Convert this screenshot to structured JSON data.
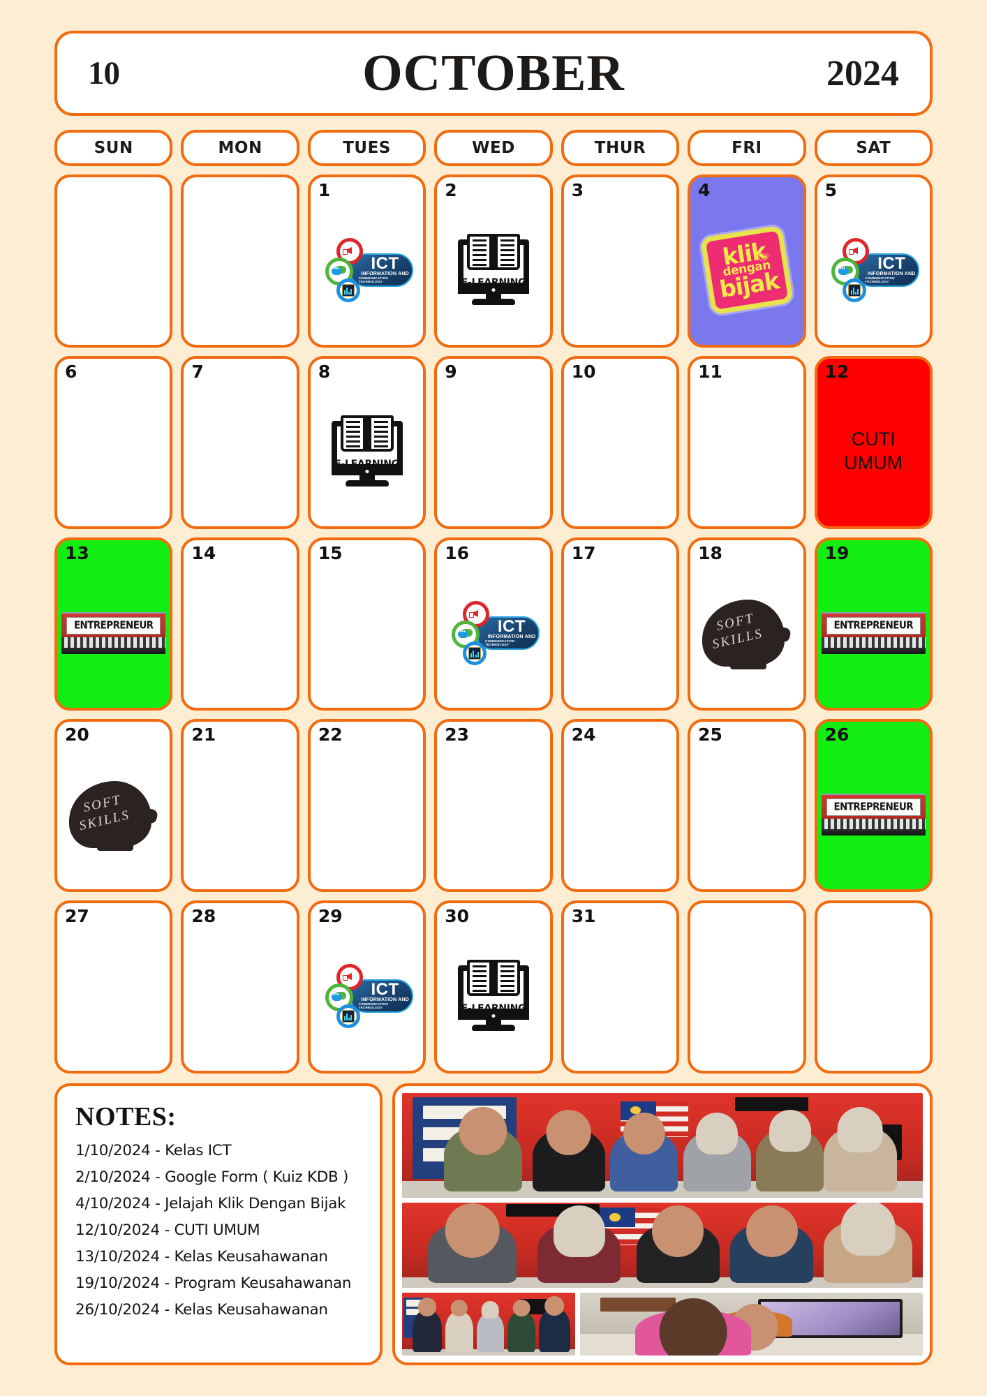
{
  "header": {
    "month_number": "10",
    "month_name": "OCTOBER",
    "year": "2024"
  },
  "colors": {
    "page_background": "#FCEDD3",
    "border_orange": "#F26B0F",
    "cell_white": "#FFFFFF",
    "holiday_red": "#FF0000",
    "event_green": "#12EE12",
    "kdb_purple": "#7B78EE",
    "text_black": "#16130F"
  },
  "weekdays": [
    {
      "label": "SUN"
    },
    {
      "label": "MON"
    },
    {
      "label": "TUES"
    },
    {
      "label": "WED"
    },
    {
      "label": "THUR"
    },
    {
      "label": "FRI"
    },
    {
      "label": "SAT"
    }
  ],
  "calendar": {
    "cells": [
      {
        "day": "",
        "kind": "empty",
        "icon": "none"
      },
      {
        "day": "",
        "kind": "empty",
        "icon": "none"
      },
      {
        "day": "1",
        "kind": "plain",
        "icon": "ict-logo"
      },
      {
        "day": "2",
        "kind": "plain",
        "icon": "e-learning-monitor"
      },
      {
        "day": "3",
        "kind": "plain",
        "icon": "none"
      },
      {
        "day": "4",
        "kind": "purple",
        "icon": "klik-dengan-bijak-badge"
      },
      {
        "day": "5",
        "kind": "plain",
        "icon": "ict-logo"
      },
      {
        "day": "6",
        "kind": "plain",
        "icon": "none"
      },
      {
        "day": "7",
        "kind": "plain",
        "icon": "none"
      },
      {
        "day": "8",
        "kind": "plain",
        "icon": "e-learning-monitor"
      },
      {
        "day": "9",
        "kind": "plain",
        "icon": "none"
      },
      {
        "day": "10",
        "kind": "plain",
        "icon": "none"
      },
      {
        "day": "11",
        "kind": "plain",
        "icon": "none"
      },
      {
        "day": "12",
        "kind": "red",
        "icon": "none",
        "text": "CUTI\nUMUM"
      },
      {
        "day": "13",
        "kind": "green",
        "icon": "entrepreneur-photo"
      },
      {
        "day": "14",
        "kind": "plain",
        "icon": "none"
      },
      {
        "day": "15",
        "kind": "plain",
        "icon": "none"
      },
      {
        "day": "16",
        "kind": "plain",
        "icon": "ict-logo"
      },
      {
        "day": "17",
        "kind": "plain",
        "icon": "none"
      },
      {
        "day": "18",
        "kind": "plain",
        "icon": "soft-skills-head"
      },
      {
        "day": "19",
        "kind": "green",
        "icon": "entrepreneur-photo"
      },
      {
        "day": "20",
        "kind": "plain",
        "icon": "soft-skills-head"
      },
      {
        "day": "21",
        "kind": "plain",
        "icon": "none"
      },
      {
        "day": "22",
        "kind": "plain",
        "icon": "none"
      },
      {
        "day": "23",
        "kind": "plain",
        "icon": "none"
      },
      {
        "day": "24",
        "kind": "plain",
        "icon": "none"
      },
      {
        "day": "25",
        "kind": "plain",
        "icon": "none"
      },
      {
        "day": "26",
        "kind": "green",
        "icon": "entrepreneur-photo"
      },
      {
        "day": "27",
        "kind": "plain",
        "icon": "none"
      },
      {
        "day": "28",
        "kind": "plain",
        "icon": "none"
      },
      {
        "day": "29",
        "kind": "plain",
        "icon": "ict-logo"
      },
      {
        "day": "30",
        "kind": "plain",
        "icon": "e-learning-monitor"
      },
      {
        "day": "31",
        "kind": "plain",
        "icon": "none"
      },
      {
        "day": "",
        "kind": "empty",
        "icon": "none"
      },
      {
        "day": "",
        "kind": "empty",
        "icon": "none"
      }
    ]
  },
  "icons": {
    "ict": {
      "title": "ICT",
      "line1": "INFORMATION AND",
      "line2": "COMMUNICATION TECHNOLOGY"
    },
    "elearning": {
      "label": "E-LEARNING"
    },
    "kdb": {
      "line1": "klik",
      "line2": "dengan",
      "line3": "bijak"
    },
    "entrepreneur": {
      "label": "ENTREPRENEUR"
    },
    "softskills": {
      "line1": "SOFT",
      "line2": "SKILLS"
    }
  },
  "notes": {
    "title": "NOTES:",
    "items": [
      {
        "text": "1/10/2024 -  Kelas ICT"
      },
      {
        "text": "2/10/2024 -  Google Form ( Kuiz KDB )"
      },
      {
        "text": "4/10/2024 - Jelajah Klik Dengan Bijak"
      },
      {
        "text": "12/10/2024  - CUTI UMUM"
      },
      {
        "text": "13/10/2024 - Kelas Keusahawanan"
      },
      {
        "text": "19/10/2024 - Program Keusahawanan"
      },
      {
        "text": "26/10/2024 - Kelas Keusahawanan"
      }
    ]
  },
  "gallery": {
    "photos": [
      {
        "caption": "group-photo-six-people-lundu-room"
      },
      {
        "caption": "group-photo-five-people-malaysian-flag"
      },
      {
        "caption": "group-photo-five-people-red-wall"
      },
      {
        "caption": "student-at-computer-with-headphones"
      }
    ]
  }
}
